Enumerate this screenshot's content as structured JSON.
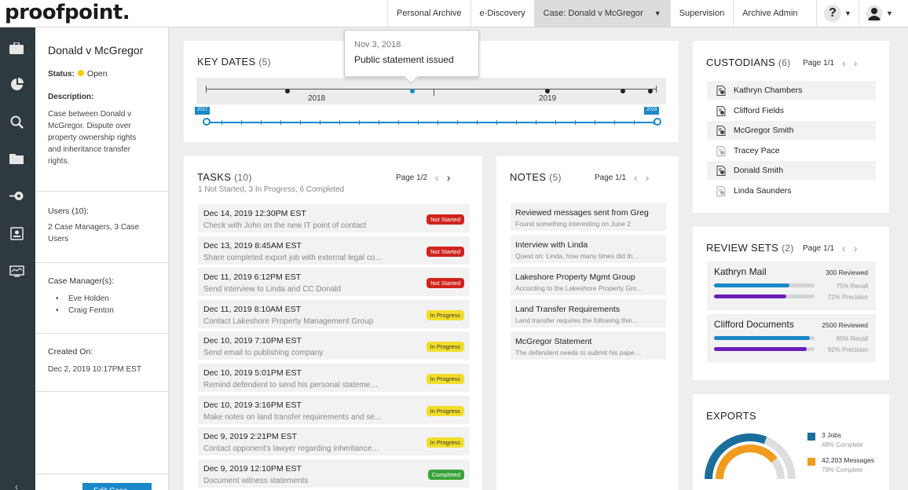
{
  "brand": {
    "logo": "proofpoint",
    "logo_dot": "."
  },
  "nav": {
    "items": [
      "Personal Archive",
      "e-Discovery",
      "Case: Donald v McGregor",
      "Supervision",
      "Archive Admin"
    ],
    "help": "?"
  },
  "sidebar_icons": [
    "briefcase-icon",
    "pie-chart-icon",
    "search-icon",
    "folder-icon",
    "key-icon",
    "id-card-icon",
    "monitor-icon"
  ],
  "case": {
    "title": "Donald v McGregor",
    "status_label": "Status:",
    "status_value": "Open",
    "description_label": "Description:",
    "description": "Case between Donald v McGregor. Dispute over property ownership rights and inheritance transfer rights.",
    "users_label": "Users (10):",
    "users_text": "2 Case Managers, 3 Case Users",
    "managers_label": "Case Manager(s):",
    "managers": [
      "Eve Holden",
      "Craig Fenton"
    ],
    "created_label": "Created On:",
    "created_value": "Dec 2, 2019 10:17PM EST",
    "edit_button": "Edit Case"
  },
  "key_dates": {
    "title": "KEY DATES",
    "count": "(5)",
    "year_labels": [
      "2018",
      "2019"
    ],
    "range_start": "2017",
    "range_end": "2019",
    "tooltip_date": "Nov 3, 2018",
    "tooltip_text": "Public statement issued"
  },
  "tasks": {
    "title": "TASKS",
    "count": "(10)",
    "summary": "1 Not Started, 3 In Progress, 6 Completed",
    "page": "Page 1/2",
    "items": [
      {
        "date": "Dec 14, 2019 12:30PM EST",
        "desc": "Check with John on the new IT point of contact",
        "status": "Not Started"
      },
      {
        "date": "Dec 13, 2019 8:45AM EST",
        "desc": "Share completed export job with external legal co…",
        "status": "Not Started"
      },
      {
        "date": "Dec 11, 2019 6:12PM EST",
        "desc": "Send interview to Linda and CC Donald",
        "status": "Not Started"
      },
      {
        "date": "Dec 11, 2019 8:10AM EST",
        "desc": "Contact Lakeshore Property Management Group",
        "status": "In Progress"
      },
      {
        "date": "Dec 10, 2019 7:10PM EST",
        "desc": "Send email to publishing company",
        "status": "In Progress"
      },
      {
        "date": "Dec 10, 2019 5:01PM EST",
        "desc": "Remind defendent to send his personal stateme…",
        "status": "In Progress"
      },
      {
        "date": "Dec 10, 2019 3:16PM EST",
        "desc": "Make notes on land transfer requirements and se…",
        "status": "In Progress"
      },
      {
        "date": "Dec 9, 2019 2:21PM EST",
        "desc": "Contact opponent's lawyer regarding inheritance…",
        "status": "In Progress"
      },
      {
        "date": "Dec 9, 2019 12:10PM EST",
        "desc": "Document witness statements",
        "status": "Completed"
      }
    ]
  },
  "notes": {
    "title": "NOTES",
    "count": "(5)",
    "page": "Page 1/1",
    "items": [
      {
        "title": "Reviewed messages sent from Greg",
        "sub": "Found something interesting on June 2"
      },
      {
        "title": "Interview with Linda",
        "sub": "Quest on: Linda, how many times did th…"
      },
      {
        "title": "Lakeshore Property Mgmt Group",
        "sub": "According to the Lakeshore Property Gro…"
      },
      {
        "title": "Land Transfer Requirements",
        "sub": "Land transfer requires the following thin…"
      },
      {
        "title": "McGregor Statement",
        "sub": "The defendent needs to submit his pape…"
      }
    ]
  },
  "custodians": {
    "title": "CUSTODIANS",
    "count": "(6)",
    "page": "Page 1/1",
    "items": [
      "Kathryn Chambers",
      "Clifford Fields",
      "McGregor Smith",
      "Tracey Pace",
      "Donald Smith",
      "Linda Saunders"
    ]
  },
  "review_sets": {
    "title": "REVIEW SETS",
    "count": "(2)",
    "page": "Page 1/1",
    "items": [
      {
        "name": "Kathryn Mail",
        "reviewed": "300 Reviewed",
        "recall_text": "75% Recall",
        "precision_text": "72% Precision",
        "recall": 0.75,
        "precision": 0.72
      },
      {
        "name": "Clifford Documents",
        "reviewed": "2500 Reviewed",
        "recall_text": "95% Recall",
        "precision_text": "92% Precision",
        "recall": 0.95,
        "precision": 0.92
      }
    ]
  },
  "exports": {
    "title": "EXPORTS",
    "legend": [
      {
        "label": "3 Jobs",
        "sub": "48% Complete",
        "color": "#1a6f9a",
        "fraction": 0.48
      },
      {
        "label": "42,203 Messages",
        "sub": "79% Complete",
        "color": "#f29b1d",
        "fraction": 0.79
      }
    ]
  },
  "colors": {
    "accent": "#1a88c9",
    "sidebar": "#2f3a40",
    "purple": "#6a1fb5"
  }
}
